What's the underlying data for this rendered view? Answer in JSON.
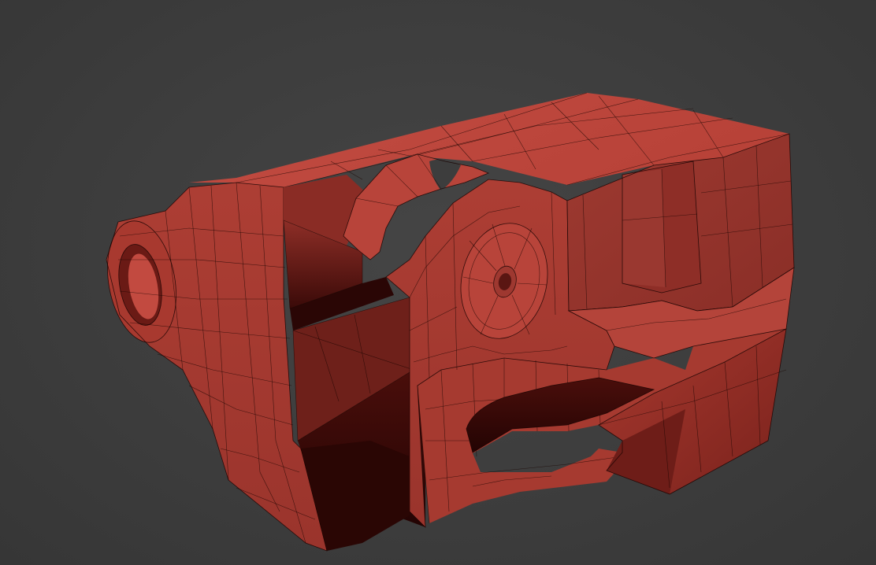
{
  "viewport": {
    "background_color": "#3f3f3f",
    "shading_mode": "shaded-with-wireframe"
  },
  "model": {
    "name": "",
    "base_color": "#b8443a",
    "light_color": "#c9544a",
    "mid_color": "#a23a30",
    "shadow_color": "#7d2520",
    "deep_shadow_color": "#3a0a08",
    "wire_color": "#1a0402"
  }
}
